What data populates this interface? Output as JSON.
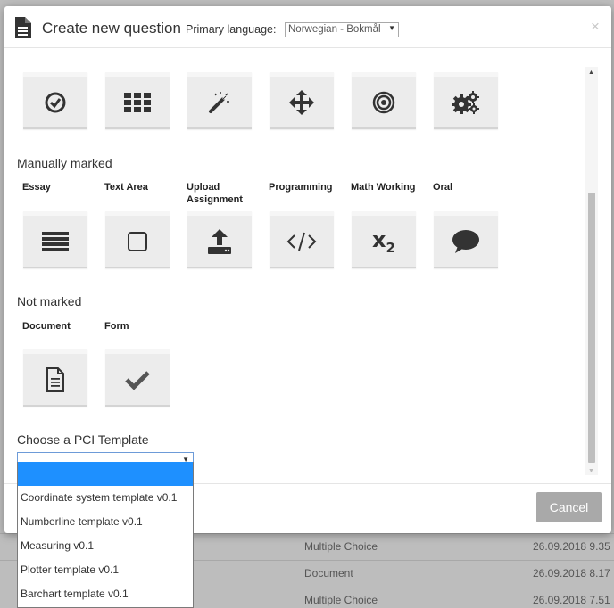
{
  "modal": {
    "title": "Create new question",
    "language_label": "Primary language:",
    "language_value": "Norwegian - Bokmål",
    "close_label": "×"
  },
  "auto_tiles": [
    {
      "icon": "check-circle-icon"
    },
    {
      "icon": "grid-icon"
    },
    {
      "icon": "magic-wand-icon"
    },
    {
      "icon": "move-arrows-icon"
    },
    {
      "icon": "target-icon"
    },
    {
      "icon": "gears-icon"
    }
  ],
  "sections": {
    "manual": {
      "title": "Manually marked",
      "items": [
        {
          "label": "Essay",
          "icon": "lines-icon"
        },
        {
          "label": "Text Area",
          "icon": "square-icon"
        },
        {
          "label": "Upload Assignment",
          "icon": "upload-icon"
        },
        {
          "label": "Programming",
          "icon": "code-icon"
        },
        {
          "label": "Math Working",
          "icon": "subscript-icon",
          "glyph": "x",
          "sub": "2"
        },
        {
          "label": "Oral",
          "icon": "speech-bubble-icon"
        }
      ]
    },
    "not_marked": {
      "title": "Not marked",
      "items": [
        {
          "label": "Document",
          "icon": "document-icon"
        },
        {
          "label": "Form",
          "icon": "checkmark-icon"
        }
      ]
    }
  },
  "pci": {
    "label": "Choose a PCI Template",
    "selected_value": "",
    "options": [
      "",
      "Coordinate system template v0.1",
      "Numberline template v0.1",
      "Measuring v0.1",
      "Plotter template v0.1",
      "Barchart template v0.1"
    ]
  },
  "footer": {
    "cancel_label": "Cancel"
  },
  "background_rows": [
    {
      "type": "Multiple Choice",
      "date": "26.09.2018 9.35"
    },
    {
      "type": "Document",
      "date": "26.09.2018 8.17"
    },
    {
      "type": "Multiple Choice",
      "date": "26.09.2018 7.51"
    }
  ],
  "colors": {
    "accent": "#1e90ff",
    "cancel_bg": "#a9a9a9",
    "tile_bg": "#ececec"
  }
}
